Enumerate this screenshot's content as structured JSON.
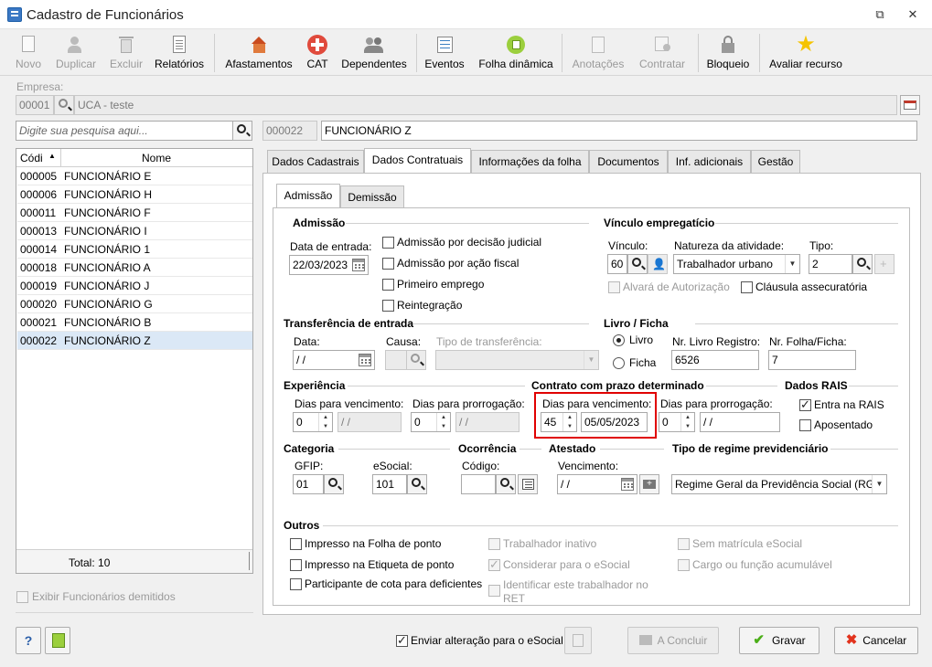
{
  "window": {
    "title": "Cadastro de Funcionários"
  },
  "toolbar": {
    "novo": "Novo",
    "duplicar": "Duplicar",
    "excluir": "Excluir",
    "relatorios": "Relatórios",
    "afastamentos": "Afastamentos",
    "cat": "CAT",
    "dependentes": "Dependentes",
    "eventos": "Eventos",
    "folha": "Folha dinâmica",
    "anotacoes": "Anotações",
    "contratar": "Contratar",
    "bloqueio": "Bloqueio",
    "avaliar": "Avaliar recurso"
  },
  "empresa": {
    "label": "Empresa:",
    "code": "00001",
    "name": "UCA - teste"
  },
  "search": {
    "placeholder": "Digite sua pesquisa aqui..."
  },
  "employee": {
    "code": "000022",
    "name": "FUNCIONÁRIO Z"
  },
  "grid": {
    "col_code": "Códi",
    "col_name": "Nome",
    "rows": [
      {
        "code": "000005",
        "name": "FUNCIONÁRIO E"
      },
      {
        "code": "000006",
        "name": "FUNCIONÁRIO H"
      },
      {
        "code": "000011",
        "name": "FUNCIONÁRIO F"
      },
      {
        "code": "000013",
        "name": "FUNCIONÁRIO I"
      },
      {
        "code": "000014",
        "name": "FUNCIONÁRIO 1"
      },
      {
        "code": "000018",
        "name": "FUNCIONÁRIO A"
      },
      {
        "code": "000019",
        "name": "FUNCIONÁRIO J"
      },
      {
        "code": "000020",
        "name": "FUNCIONÁRIO G"
      },
      {
        "code": "000021",
        "name": "FUNCIONÁRIO B"
      },
      {
        "code": "000022",
        "name": "FUNCIONÁRIO Z"
      }
    ],
    "total": "Total: 10"
  },
  "exibir_demitidos": "Exibir Funcionários demitidos",
  "tabs": [
    "Dados Cadastrais",
    "Dados Contratuais",
    "Informações da folha",
    "Documentos",
    "Inf. adicionais",
    "Gestão"
  ],
  "subtabs": [
    "Admissão",
    "Demissão"
  ],
  "admissao": {
    "title": "Admissão",
    "data_label": "Data de entrada:",
    "data": "22/03/2023",
    "chk1": "Admissão por decisão judicial",
    "chk2": "Admissão por ação fiscal",
    "chk3": "Primeiro emprego",
    "chk4": "Reintegração"
  },
  "vinculo": {
    "title": "Vínculo empregatício",
    "vinculo_label": "Vínculo:",
    "vinculo": "60",
    "natureza_label": "Natureza da atividade:",
    "natureza": "Trabalhador urbano",
    "tipo_label": "Tipo:",
    "tipo": "2",
    "alvara": "Alvará de Autorização",
    "clausula": "Cláusula assecuratória"
  },
  "transferencia": {
    "title": "Transferência de entrada",
    "data_label": "Data:",
    "data": " / /",
    "causa_label": "Causa:",
    "tipo_label": "Tipo de transferência:"
  },
  "livro": {
    "title": "Livro / Ficha",
    "livro": "Livro",
    "ficha": "Ficha",
    "nr_livro_label": "Nr. Livro Registro:",
    "nr_livro": "6526",
    "nr_folha_label": "Nr. Folha/Ficha:",
    "nr_folha": "7"
  },
  "experiencia": {
    "title": "Experiência",
    "dias_venc_label": "Dias para vencimento:",
    "dias_venc": "0",
    "data_venc": " / /",
    "dias_prorr_label": "Dias para prorrogação:",
    "dias_prorr": "0",
    "data_prorr": " / /"
  },
  "contrato": {
    "title": "Contrato com prazo determinado",
    "dias_venc_label": "Dias para vencimento:",
    "dias_venc": "45",
    "data_venc": "05/05/2023",
    "dias_prorr_label": "Dias para prorrogação:",
    "dias_prorr": "0",
    "data_prorr": " / /",
    "highlight": "#e00000"
  },
  "rais": {
    "title": "Dados RAIS",
    "entra": "Entra na RAIS",
    "aposentado": "Aposentado"
  },
  "categoria": {
    "title": "Categoria",
    "gfip_label": "GFIP:",
    "gfip": "01",
    "esocial_label": "eSocial:",
    "esocial": "101"
  },
  "ocorrencia": {
    "title": "Ocorrência",
    "codigo_label": "Código:"
  },
  "atestado": {
    "title": "Atestado",
    "venc_label": "Vencimento:",
    "venc": " / /"
  },
  "regime": {
    "title": "Tipo de regime previdenciário",
    "value": "Regime Geral da Previdência Social (RGP"
  },
  "outros": {
    "title": "Outros",
    "o1": "Impresso na Folha de ponto",
    "o2": "Impresso na Etiqueta de ponto",
    "o3": "Participante de cota para deficientes",
    "o4": "Trabalhador inativo",
    "o5": "Considerar para o eSocial",
    "o6": "Identificar este trabalhador no",
    "o6b": "RET",
    "o7": "Sem matrícula eSocial",
    "o8": "Cargo ou função acumulável"
  },
  "footer": {
    "help": "?",
    "enviar": "Enviar alteração para o eSocial",
    "concluir": "A Concluir",
    "gravar": "Gravar",
    "cancelar": "Cancelar"
  }
}
